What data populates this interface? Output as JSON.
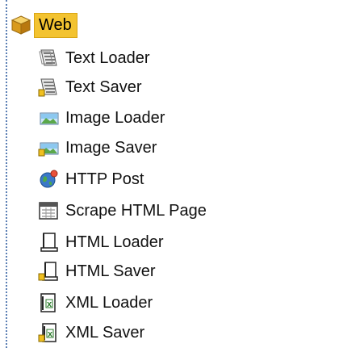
{
  "tree": {
    "root": {
      "label": "Web",
      "icon": "cube-icon"
    },
    "items": [
      {
        "label": "Text Loader",
        "icon": "text-loader-icon"
      },
      {
        "label": "Text Saver",
        "icon": "text-saver-icon"
      },
      {
        "label": "Image Loader",
        "icon": "image-loader-icon"
      },
      {
        "label": "Image Saver",
        "icon": "image-saver-icon"
      },
      {
        "label": "HTTP Post",
        "icon": "globe-icon"
      },
      {
        "label": "Scrape HTML Page",
        "icon": "calendar-page-icon"
      },
      {
        "label": "HTML Loader",
        "icon": "html-loader-icon"
      },
      {
        "label": "HTML Saver",
        "icon": "html-saver-icon"
      },
      {
        "label": "XML Loader",
        "icon": "xml-loader-icon"
      },
      {
        "label": "XML Saver",
        "icon": "xml-saver-icon"
      }
    ]
  },
  "colors": {
    "selection_bg": "#f3c330",
    "tree_guide": "#5b7fb4"
  }
}
